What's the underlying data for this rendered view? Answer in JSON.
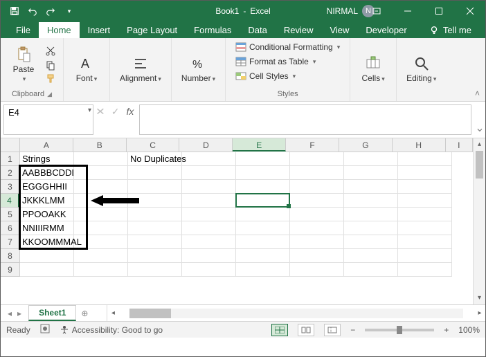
{
  "title": {
    "doc": "Book1",
    "sep": " - ",
    "app": "Excel"
  },
  "user": {
    "name": "NIRMAL",
    "initial": "N"
  },
  "tabs": {
    "file": "File",
    "home": "Home",
    "insert": "Insert",
    "pagelayout": "Page Layout",
    "formulas": "Formulas",
    "data": "Data",
    "review": "Review",
    "view": "View",
    "developer": "Developer",
    "tellme": "Tell me"
  },
  "ribbon": {
    "clipboard": {
      "paste": "Paste",
      "label": "Clipboard"
    },
    "font": {
      "btn": "Font"
    },
    "alignment": {
      "btn": "Alignment"
    },
    "number": {
      "btn": "Number"
    },
    "styles": {
      "cond": "Conditional Formatting",
      "table": "Format as Table",
      "cell": "Cell Styles",
      "label": "Styles"
    },
    "cells": {
      "btn": "Cells"
    },
    "editing": {
      "btn": "Editing"
    }
  },
  "namebox": "E4",
  "columns": [
    "A",
    "B",
    "C",
    "D",
    "E",
    "F",
    "G",
    "H",
    "I"
  ],
  "rows": [
    "1",
    "2",
    "3",
    "4",
    "5",
    "6",
    "7",
    "8",
    "9"
  ],
  "sheet": {
    "A1": "Strings",
    "C1": "No Duplicates",
    "A2": "AABBBCDDD",
    "A3": "EGGGHHII",
    "A4": "JKKKLMM",
    "A5": "PPOOAKK",
    "A6": "NNIIIRMM",
    "A7": "KKOOMMMAL"
  },
  "sheettab": {
    "name": "Sheet1"
  },
  "status": {
    "ready": "Ready",
    "rec": "",
    "acc": "Accessibility: Good to go",
    "zoom": "100%"
  }
}
